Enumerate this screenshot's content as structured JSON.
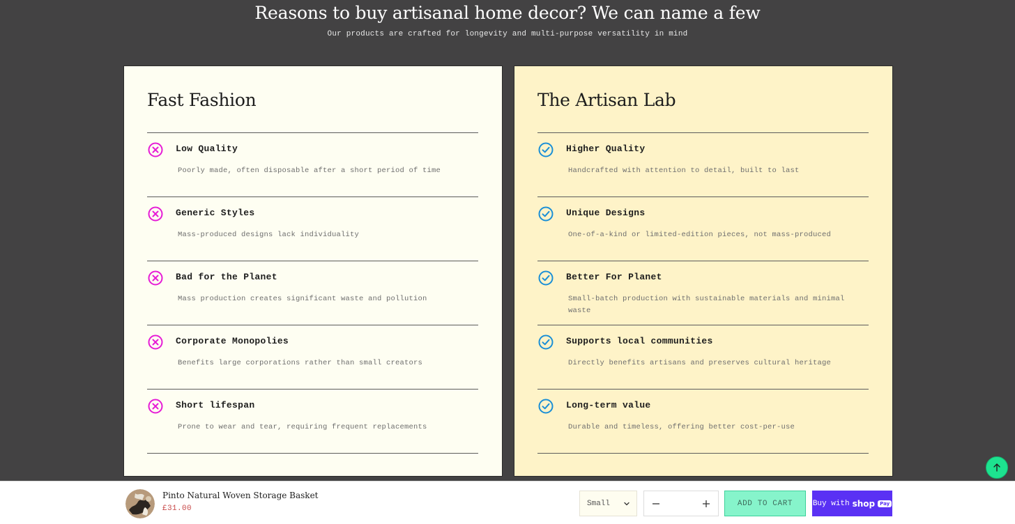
{
  "hero": {
    "title": "Reasons to buy artisanal home decor? We can name a few",
    "subtitle": "Our products are crafted for longevity and multi-purpose versatility in mind"
  },
  "comparison": {
    "left": {
      "title": "Fast Fashion",
      "icon": "x-circle-icon",
      "icon_color": "#e61cd6",
      "items": [
        {
          "title": "Low Quality",
          "desc": "Poorly made, often disposable after a short period of time"
        },
        {
          "title": "Generic Styles",
          "desc": "Mass-produced designs lack individuality"
        },
        {
          "title": "Bad for the Planet",
          "desc": "Mass production creates significant waste and pollution"
        },
        {
          "title": "Corporate Monopolies",
          "desc": "Benefits large corporations rather than small creators"
        },
        {
          "title": "Short lifespan",
          "desc": "Prone to wear and tear, requiring frequent replacements"
        }
      ]
    },
    "right": {
      "title": "The Artisan Lab",
      "icon": "check-circle-icon",
      "icon_color": "#1a8fd6",
      "items": [
        {
          "title": "Higher Quality",
          "desc": "Handcrafted with attention to detail, built to last"
        },
        {
          "title": "Unique Designs",
          "desc": "One-of-a-kind or limited-edition pieces, not mass-produced"
        },
        {
          "title": "Better For Planet",
          "desc": "Small-batch production with sustainable materials and minimal waste"
        },
        {
          "title": "Supports local communities",
          "desc": "Directly benefits artisans and preserves cultural heritage"
        },
        {
          "title": "Long-term value",
          "desc": "Durable and timeless, offering better cost-per-use"
        }
      ]
    }
  },
  "scroll_top": {
    "icon": "arrow-up-icon"
  },
  "sticky_bar": {
    "product_name": "Pinto Natural Woven Storage Basket",
    "price": "£31.00",
    "size_selected": "Small",
    "quantity": "",
    "add_to_cart": "ADD TO CART",
    "shop_pay_prefix": "Buy with",
    "shop_pay_brand": "shop",
    "shop_pay_badge": "Pay"
  }
}
